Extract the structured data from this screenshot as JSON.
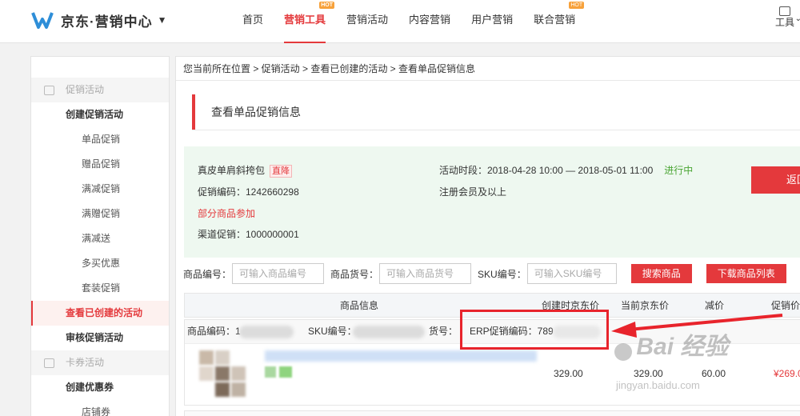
{
  "header": {
    "brand": "京东·营销中心",
    "brand_caret": "▼",
    "nav": [
      {
        "label": "首页",
        "active": false,
        "badge": ""
      },
      {
        "label": "营销工具",
        "active": true,
        "badge": "HOT"
      },
      {
        "label": "营销活动",
        "active": false,
        "badge": ""
      },
      {
        "label": "内容营销",
        "active": false,
        "badge": ""
      },
      {
        "label": "用户营销",
        "active": false,
        "badge": ""
      },
      {
        "label": "联合营销",
        "active": false,
        "badge": "HOT"
      }
    ],
    "tools_label": "工具",
    "tools_icon": "toolbox-icon"
  },
  "sidebar": {
    "groups": [
      {
        "title": "促销活动",
        "icon": "gift-icon",
        "heads": [
          {
            "label": "创建促销活动",
            "active": false
          },
          {
            "label": "查看已创建的活动",
            "active": true
          },
          {
            "label": "审核促销活动",
            "active": false
          }
        ],
        "subs": [
          "单品促销",
          "赠品促销",
          "满减促销",
          "满赠促销",
          "满减送",
          "多买优惠",
          "套装促销"
        ]
      },
      {
        "title": "卡券活动",
        "icon": "card-icon",
        "heads": [
          {
            "label": "创建优惠券",
            "active": false
          }
        ],
        "subs": [
          "店铺券"
        ]
      }
    ]
  },
  "breadcrumb": "您当前所在位置 > 促销活动 > 查看已创建的活动 > 查看单品促销信息",
  "page_title": "查看单品促销信息",
  "promo": {
    "product_name": "真皮单肩斜挎包",
    "tag": "直降",
    "promo_code": "促销编码：1242660298",
    "partial": "部分商品参加",
    "channel": "渠道促销：1000000001",
    "period": "活动时段：2018-04-28 10:00 — 2018-05-01 11:00",
    "status": "进行中",
    "member": "注册会员及以上",
    "back_label": "返回"
  },
  "search": {
    "item_no_label": "商品编号：",
    "item_no_placeholder": "可输入商品编号",
    "goods_no_label": "商品货号：",
    "goods_no_placeholder": "可输入商品货号",
    "sku_label": "SKU编号：",
    "sku_placeholder": "可输入SKU编号",
    "search_btn": "搜索商品",
    "download_btn": "下载商品列表"
  },
  "table": {
    "headers": [
      "商品信息",
      "创建时京东价",
      "当前京东价",
      "减价",
      "促销价"
    ],
    "row_head": {
      "item_code": "商品编码：1",
      "sku": "SKU编号：",
      "goods_no": "货号：",
      "erp": "ERP促销编码：789"
    },
    "row": {
      "create_price": "329.00",
      "current_price": "329.00",
      "discount": "60.00",
      "promo_price": "¥269.0"
    }
  },
  "watermark": {
    "text": "Bai 经验",
    "url": "jingyan.baidu.com"
  },
  "colors": {
    "accent": "#e4393c",
    "info_bg": "#eef8f0",
    "status_green": "#4aa533",
    "highlight": "#e8242c"
  }
}
